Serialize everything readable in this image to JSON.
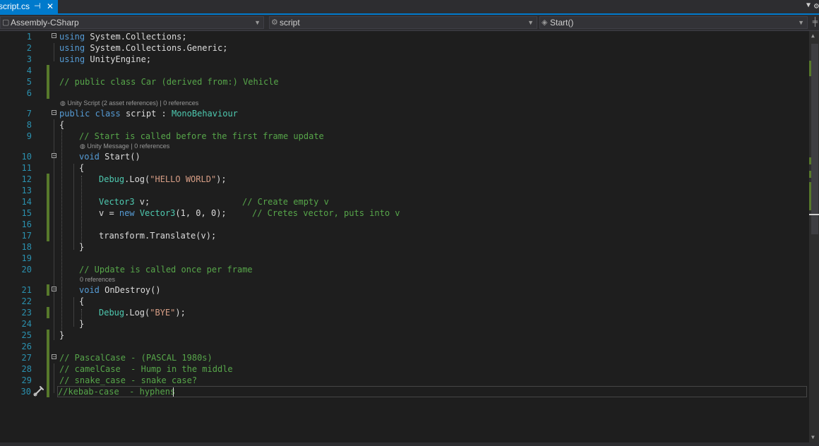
{
  "tab": {
    "file_name": "script.cs",
    "pin_icon": "pin-icon",
    "close_glyph": "✕"
  },
  "navbar": {
    "project": "Assembly-CSharp",
    "type": "script",
    "member": "Start()"
  },
  "codelens": {
    "class_info": "Unity Script (2 asset references) | 0 references",
    "start_info": "Unity Message | 0 references",
    "ondestroy_info": "0 references"
  },
  "code": {
    "l1": [
      "using",
      " System.Collections;"
    ],
    "l2": [
      "using",
      " System.Collections.Generic;"
    ],
    "l3": [
      "using",
      " UnityEngine;"
    ],
    "l5": "// public class Car (derived from:) Vehicle",
    "l7": [
      "public",
      " ",
      "class",
      " script : ",
      "MonoBehaviour"
    ],
    "l8": "{",
    "l9": "// Start is called before the first frame update",
    "l10": [
      "void",
      " Start()"
    ],
    "l11": "{",
    "l12": [
      "Debug",
      ".Log(",
      "\"HELLO WORLD\"",
      ");"
    ],
    "l14": [
      "Vector3",
      " v;",
      "// Create empty v"
    ],
    "l15": [
      "v = ",
      "new",
      " ",
      "Vector3",
      "(1, 0, 0);",
      "// Cretes vector, puts into v"
    ],
    "l17": "transform.Translate(v);",
    "l18": "}",
    "l20": "// Update is called once per frame",
    "l21": [
      "void",
      " OnDestroy()"
    ],
    "l22": "{",
    "l23": [
      "Debug",
      ".Log(",
      "\"BYE\"",
      ");"
    ],
    "l24": "}",
    "l25": "}",
    "l27": "// PascalCase - (PASCAL 1980s)",
    "l28": "// camelCase  - Hump in the middle",
    "l29": "// snake_case - snake case?",
    "l30": "//kebab-case  - hyphens"
  },
  "line_numbers": [
    "1",
    "2",
    "3",
    "4",
    "5",
    "6",
    "7",
    "8",
    "9",
    "10",
    "11",
    "12",
    "13",
    "14",
    "15",
    "16",
    "17",
    "18",
    "19",
    "20",
    "21",
    "22",
    "23",
    "24",
    "25",
    "26",
    "27",
    "28",
    "29",
    "30"
  ],
  "colors": {
    "keyword": "#569cd6",
    "type": "#4ec9b0",
    "comment": "#57a64a",
    "string": "#d69d85",
    "line_number": "#2b91af",
    "change_marker": "#57792b",
    "accent": "#007acc"
  }
}
